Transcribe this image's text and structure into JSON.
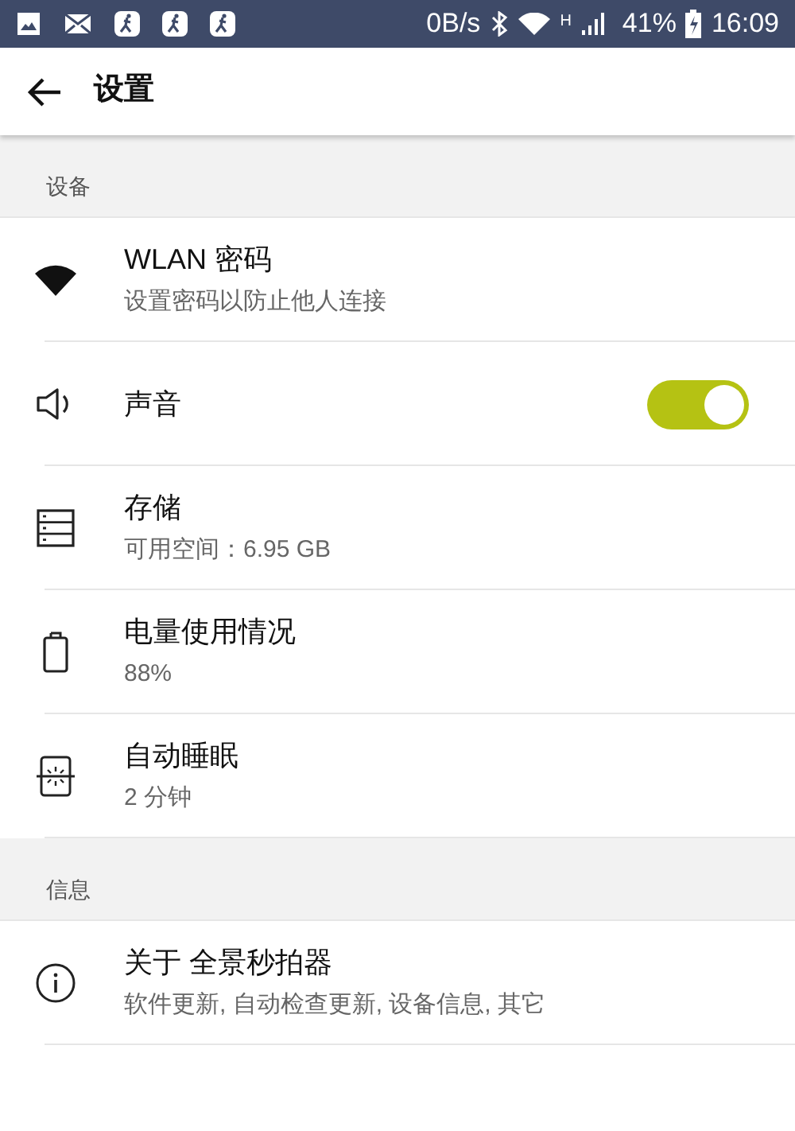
{
  "status_bar": {
    "speed": "0B/s",
    "network": "H",
    "battery": "41%",
    "time": "16:09"
  },
  "app_bar": {
    "title": "设置"
  },
  "sections": [
    {
      "header": "设备",
      "items": [
        {
          "kind": "plain",
          "title": "WLAN 密码",
          "subtitle": "设置密码以防止他人连接"
        },
        {
          "kind": "switch",
          "title": "声音",
          "on": true
        },
        {
          "kind": "plain",
          "title": "存储",
          "subtitle": "可用空间：6.95 GB"
        },
        {
          "kind": "plain",
          "title": "电量使用情况",
          "subtitle": "88%"
        },
        {
          "kind": "plain",
          "title": "自动睡眠",
          "subtitle": "2 分钟"
        }
      ]
    },
    {
      "header": "信息",
      "items": [
        {
          "kind": "plain",
          "title": "关于 全景秒拍器",
          "subtitle": "软件更新, 自动检查更新, 设备信息, 其它"
        }
      ]
    }
  ]
}
